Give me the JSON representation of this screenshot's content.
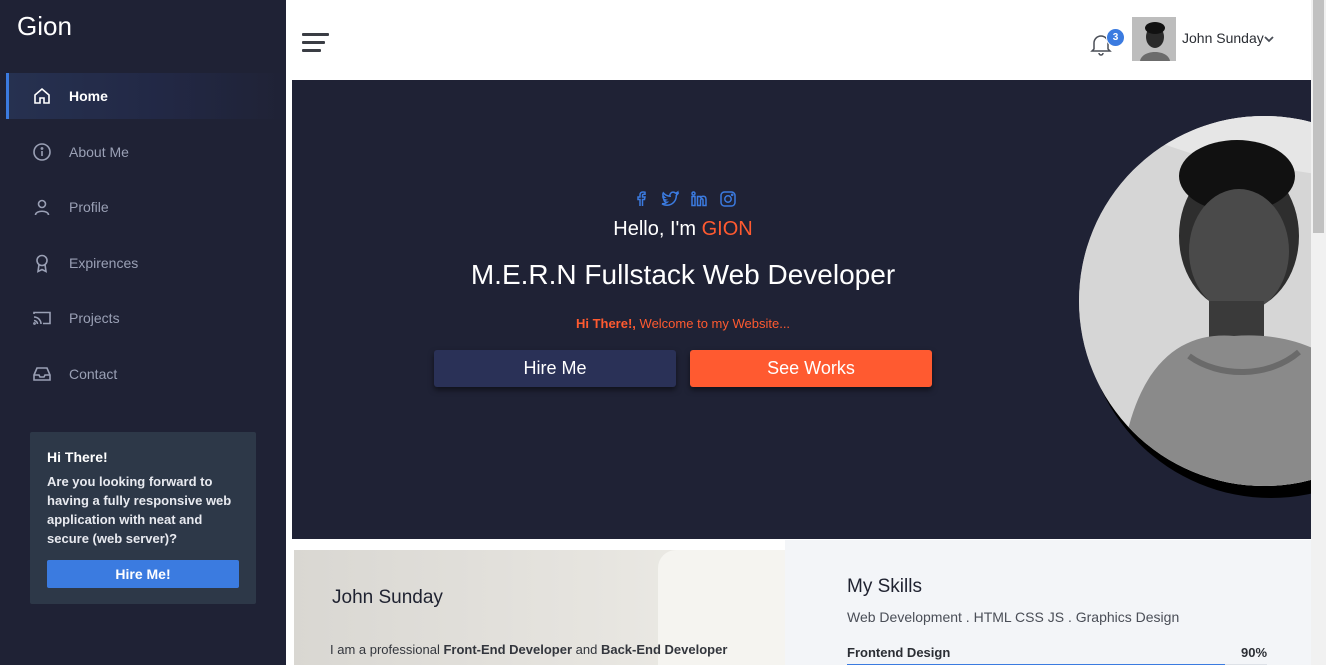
{
  "brand": {
    "name": "Gion"
  },
  "sidebar": {
    "items": [
      {
        "label": "Home",
        "icon": "home-icon",
        "active": true
      },
      {
        "label": "About Me",
        "icon": "info-icon",
        "active": false
      },
      {
        "label": "Profile",
        "icon": "user-icon",
        "active": false
      },
      {
        "label": "Expirences",
        "icon": "award-icon",
        "active": false
      },
      {
        "label": "Projects",
        "icon": "cast-icon",
        "active": false
      },
      {
        "label": "Contact",
        "icon": "inbox-icon",
        "active": false
      }
    ],
    "promo": {
      "title": "Hi There!",
      "text": "Are you looking forward to having a fully responsive web application with neat and secure (web server)?",
      "button": "Hire Me!"
    }
  },
  "topbar": {
    "notifications_count": "3",
    "user_name": "John Sunday"
  },
  "hero": {
    "socials": [
      "facebook-icon",
      "twitter-icon",
      "linkedin-icon",
      "instagram-icon"
    ],
    "hello_prefix": "Hello, I'm ",
    "hello_name": "GION",
    "role": "M.E.R.N Fullstack Web Developer",
    "welcome_bold": "Hi There!,",
    "welcome_rest": " Welcome to my Website...",
    "btn_hire": "Hire Me",
    "btn_works": "See Works"
  },
  "about": {
    "name": "John Sunday",
    "text_a": "I am a professional ",
    "text_b": "Front-End Developer",
    "text_c": " and ",
    "text_d": "Back-End Developer"
  },
  "skills": {
    "title": "My Skills",
    "subtitle": "Web Development . HTML CSS JS . Graphics Design",
    "items": [
      {
        "name": "Frontend Design",
        "percent": "90%",
        "level": 0.9
      }
    ]
  },
  "colors": {
    "sidebar_bg": "#1f2235",
    "accent_orange": "#ff5a30",
    "accent_blue": "#3b7be0",
    "hire_btn": "#2a3157"
  }
}
